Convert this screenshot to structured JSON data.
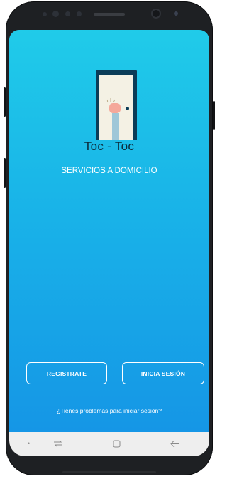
{
  "app": {
    "name": "Toc - Toc",
    "tagline": "SERVICIOS A DOMICILIO"
  },
  "actions": {
    "register_label": "REGISTRATE",
    "login_label": "INICIA SESIÓN",
    "help_link": "¿Tienes problemas para iniciar sesión?"
  },
  "navbar": {
    "icons": [
      "dot-icon",
      "recent-apps-icon",
      "home-icon",
      "back-icon"
    ]
  },
  "colors": {
    "gradient_top": "#20cbe9",
    "gradient_bottom": "#1596e6",
    "door_frame": "#0b3c57",
    "door_panel": "#f4f1e4",
    "phone_body": "#1e2023"
  }
}
